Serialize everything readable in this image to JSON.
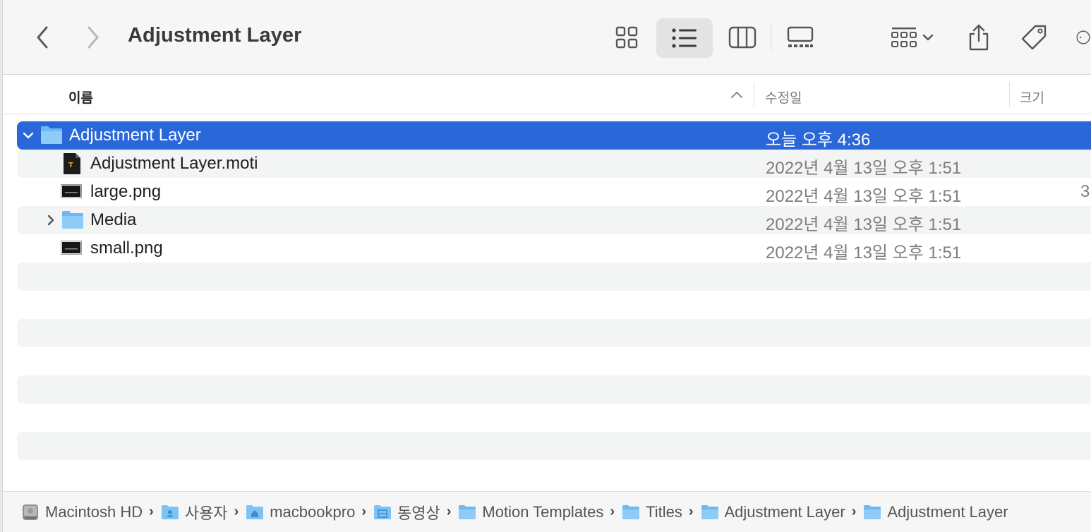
{
  "window": {
    "title": "Adjustment Layer"
  },
  "toolbar": {
    "back_icon": "chevron-left-icon",
    "forward_icon": "chevron-right-icon",
    "views": [
      "icon-view",
      "list-view",
      "column-view",
      "gallery-view"
    ],
    "active_view": "list-view",
    "group_icon": "group-by-icon",
    "share_icon": "share-icon",
    "tag_icon": "tag-icon",
    "more_icon": "more-icon"
  },
  "columns": {
    "name": "이름",
    "date": "수정일",
    "size": "크기"
  },
  "rows": [
    {
      "name": "Adjustment Layer",
      "date": "오늘 오후 4:36",
      "size": "",
      "kind": "folder",
      "expanded": true,
      "selected": true,
      "depth": 0
    },
    {
      "name": "Adjustment Layer.moti",
      "date": "2022년 4월 13일 오후 1:51",
      "size": "",
      "kind": "motion-document",
      "depth": 1
    },
    {
      "name": "large.png",
      "date": "2022년 4월 13일 오후 1:51",
      "size": "3",
      "kind": "png-image",
      "depth": 1
    },
    {
      "name": "Media",
      "date": "2022년 4월 13일 오후 1:51",
      "size": "",
      "kind": "folder",
      "expanded": false,
      "depth": 1
    },
    {
      "name": "small.png",
      "date": "2022년 4월 13일 오후 1:51",
      "size": "",
      "kind": "png-image",
      "depth": 1
    }
  ],
  "pathbar": [
    {
      "label": "Macintosh HD",
      "icon": "hard-drive-icon"
    },
    {
      "label": "사용자",
      "icon": "users-folder-icon"
    },
    {
      "label": "macbookpro",
      "icon": "home-folder-icon"
    },
    {
      "label": "동영상",
      "icon": "movies-folder-icon"
    },
    {
      "label": "Motion Templates",
      "icon": "folder-icon"
    },
    {
      "label": "Titles",
      "icon": "folder-icon"
    },
    {
      "label": "Adjustment Layer",
      "icon": "folder-icon"
    },
    {
      "label": "Adjustment Layer",
      "icon": "folder-icon"
    }
  ],
  "colors": {
    "selection": "#2a67d8",
    "folder_blue": "#7ec3f5",
    "stripe": "#f3f4f4"
  }
}
